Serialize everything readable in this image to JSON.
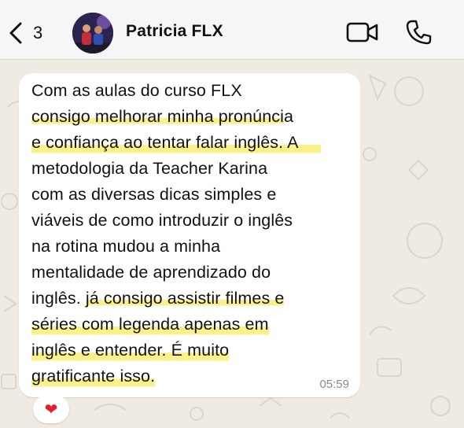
{
  "header": {
    "back_count": "3",
    "contact_name": "Patricia FLX"
  },
  "message": {
    "lines": [
      "Com as aulas do curso FLX",
      "consigo melhorar minha pronúncia",
      "e confiança ao tentar falar inglês. A",
      "metodologia da Teacher Karina",
      "com as diversas dicas simples e",
      "viáveis de como introduzir o inglês",
      "na rotina  mudou a minha",
      "mentalidade de aprendizado do",
      "inglês. já consigo assistir filmes e",
      "séries com legenda apenas em",
      "inglês e entender. É muito",
      "gratificante isso."
    ],
    "line2_plain": "consigo melhorar minha pronúnci",
    "line2_tail": "a",
    "line9_plain": "inglês. ",
    "line9_highlight": "já consigo assistir filmes e",
    "time": "05:59",
    "reaction": "❤"
  },
  "colors": {
    "highlight": "#fbf18a",
    "background": "#efeae2",
    "bubble": "#ffffff"
  },
  "icons": [
    "back-chevron-icon",
    "video-camera-icon",
    "phone-icon",
    "heart-reaction"
  ]
}
